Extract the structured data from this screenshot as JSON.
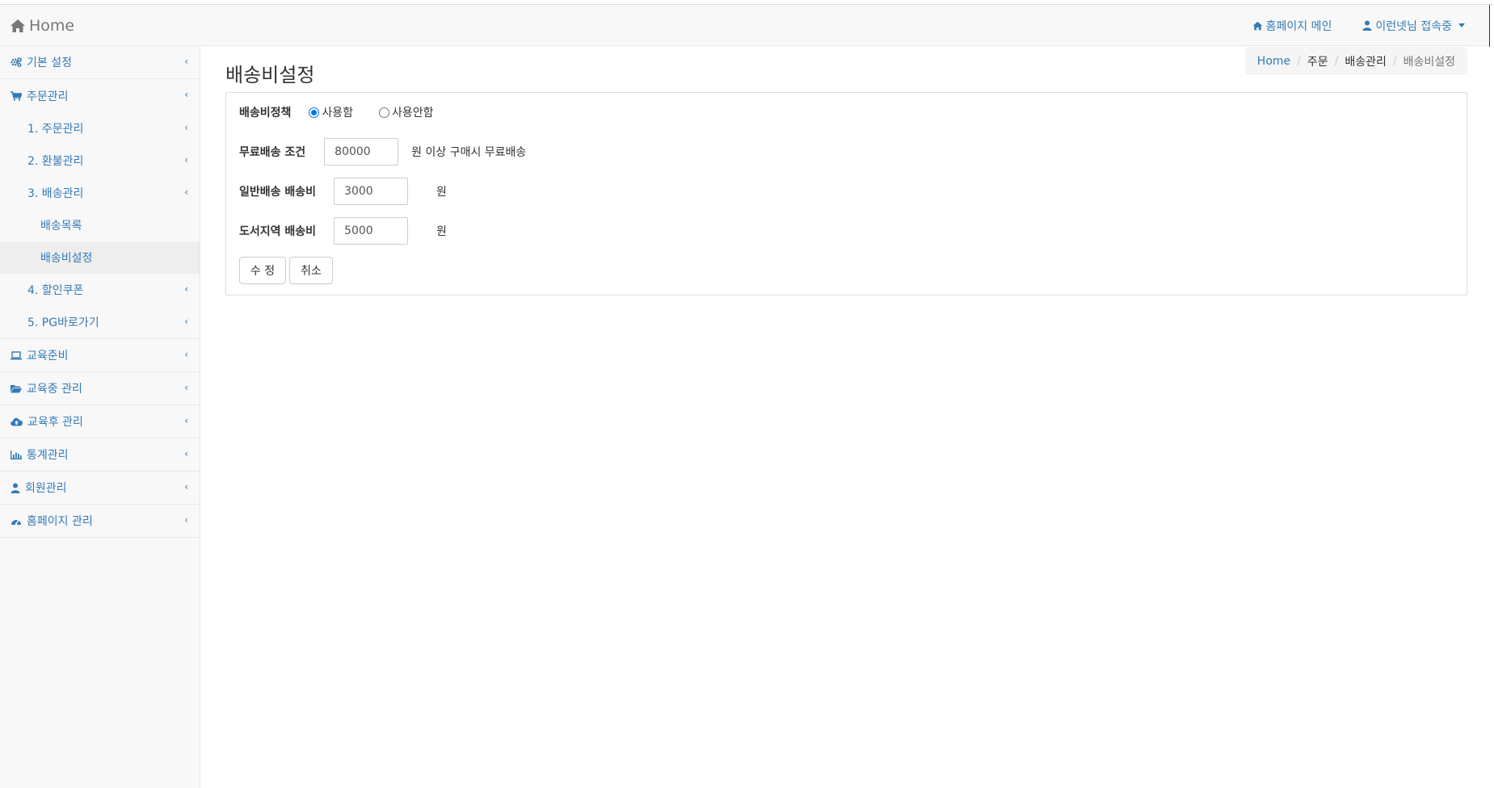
{
  "navbar": {
    "brand": "Home",
    "homepage_link": "홈페이지 메인",
    "user_menu": "이런넷님 접속중"
  },
  "sidebar": {
    "items": [
      {
        "label": "기본 설정",
        "icon": "gears-icon"
      },
      {
        "label": "주문관리",
        "icon": "cart-icon"
      },
      {
        "label": "1. 주문관리"
      },
      {
        "label": "2. 환불관리"
      },
      {
        "label": "3. 배송관리"
      },
      {
        "label": "배송목록"
      },
      {
        "label": "배송비설정"
      },
      {
        "label": "4. 할인쿠폰"
      },
      {
        "label": "5. PG바로가기"
      },
      {
        "label": "교육준비",
        "icon": "laptop-icon"
      },
      {
        "label": "교육중 관리",
        "icon": "folder-open-icon"
      },
      {
        "label": "교육후 관리",
        "icon": "cloud-upload-icon"
      },
      {
        "label": "통계관리",
        "icon": "bar-chart-icon"
      },
      {
        "label": "회원관리",
        "icon": "user-icon"
      },
      {
        "label": "홈페이지 관리",
        "icon": "dashboard-icon"
      }
    ]
  },
  "page": {
    "title": "배송비설정",
    "breadcrumb": [
      "Home",
      "주문",
      "배송관리",
      "배송비설정"
    ]
  },
  "form": {
    "policy_label": "배송비정책",
    "policy_on": "사용함",
    "policy_off": "사용안함",
    "free_label": "무료배송 조건",
    "free_value": "80000",
    "free_unit": "원 이상 구매시 무료배송",
    "normal_label": "일반배송 배송비",
    "normal_value": "3000",
    "normal_unit": "원",
    "island_label": "도서지역 배송비",
    "island_value": "5000",
    "island_unit": "원",
    "save_label": "수 정",
    "cancel_label": "취소"
  },
  "colors": {
    "link": "#337ab7",
    "radio": "#0075ff"
  }
}
